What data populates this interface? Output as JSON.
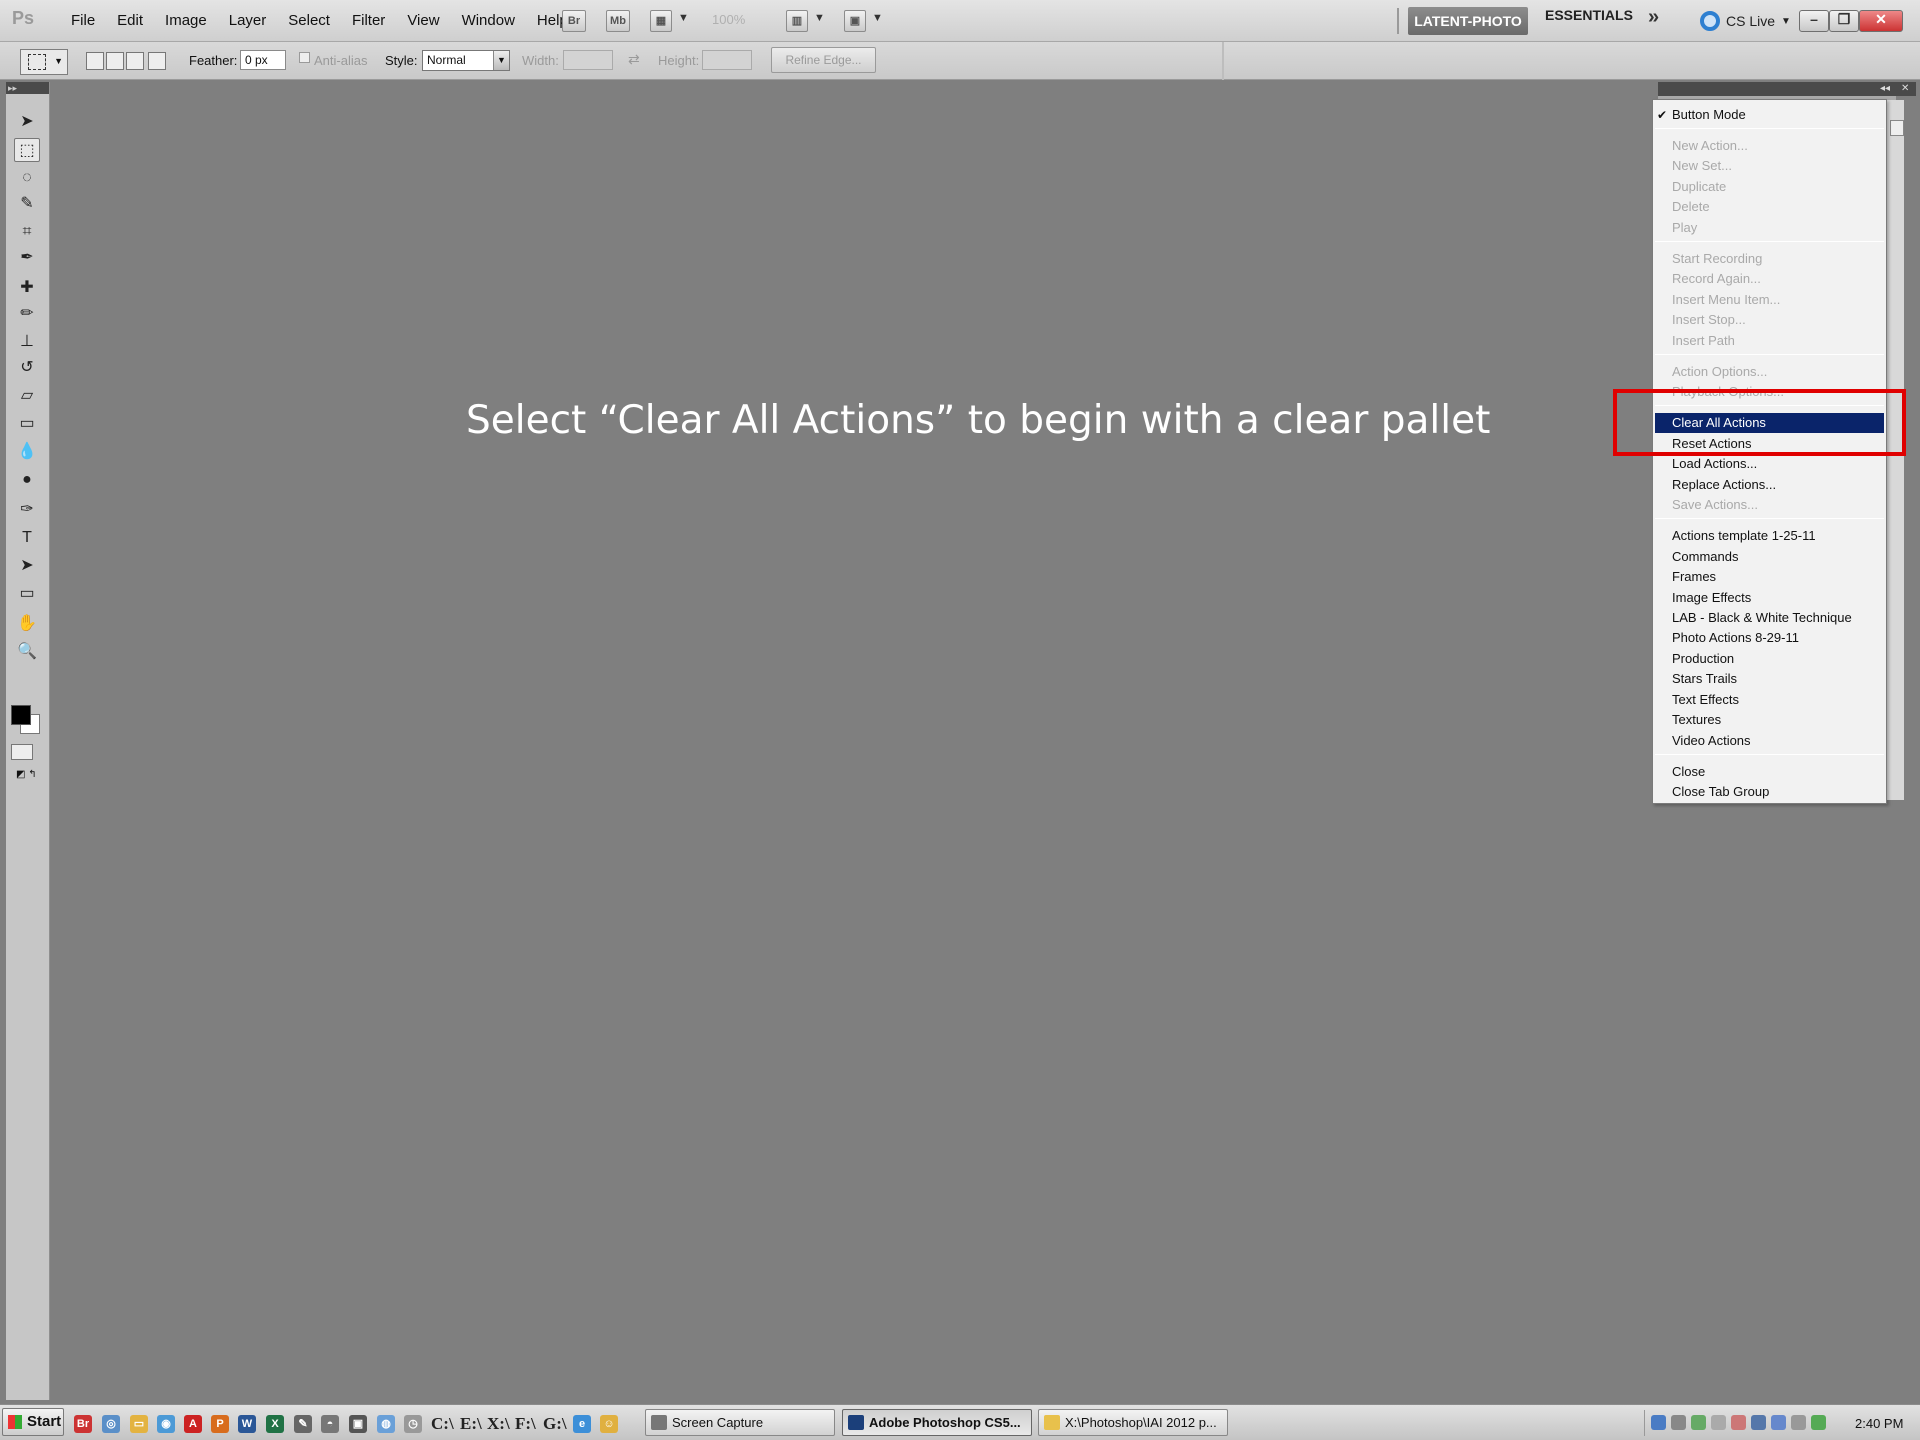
{
  "app": {
    "logo": "Ps",
    "menus": [
      "File",
      "Edit",
      "Image",
      "Layer",
      "Select",
      "Filter",
      "View",
      "Window",
      "Help"
    ],
    "toolbar_icons": [
      "Br",
      "Mb"
    ],
    "zoom": "100%",
    "workspace_active": "LATENT-PHOTO",
    "workspace_essentials": "ESSENTIALS",
    "workspace_more": "»",
    "cs_live": "CS Live"
  },
  "options": {
    "feather_label": "Feather:",
    "feather_value": "0 px",
    "anti_alias_label": "Anti-alias",
    "style_label": "Style:",
    "style_value": "Normal",
    "width_label": "Width:",
    "height_label": "Height:",
    "refine_edge": "Refine Edge..."
  },
  "annotation": "Select “Clear All Actions” to begin with a clear pallet",
  "flyout": {
    "button_mode": "Button Mode",
    "group1": [
      "New Action...",
      "New Set...",
      "Duplicate",
      "Delete",
      "Play"
    ],
    "group2": [
      "Start Recording",
      "Record Again...",
      "Insert Menu Item...",
      "Insert Stop...",
      "Insert Path"
    ],
    "group3": [
      "Action Options...",
      "Playback Options..."
    ],
    "group4": [
      "Clear All Actions",
      "Reset Actions",
      "Load Actions...",
      "Replace Actions...",
      "Save Actions..."
    ],
    "sets": [
      "Actions template 1-25-11",
      "Commands",
      "Frames",
      "Image Effects",
      "LAB - Black & White Technique",
      "Photo Actions 8-29-11",
      "Production",
      "Stars Trails",
      "Text Effects",
      "Textures",
      "Video Actions"
    ],
    "group6": [
      "Close",
      "Close Tab Group"
    ]
  },
  "taskbar": {
    "start": "Start",
    "drives": [
      "C:\\",
      "E:\\",
      "X:\\",
      "F:\\",
      "G:\\"
    ],
    "tasks": [
      "Screen Capture",
      "Adobe Photoshop CS5...",
      "X:\\Photoshop\\IAI 2012 p..."
    ],
    "clock": "2:40 PM"
  },
  "colors": {
    "canvas": "#7f7f7f",
    "highlight": "#0a246a",
    "callout": "#e00000"
  }
}
